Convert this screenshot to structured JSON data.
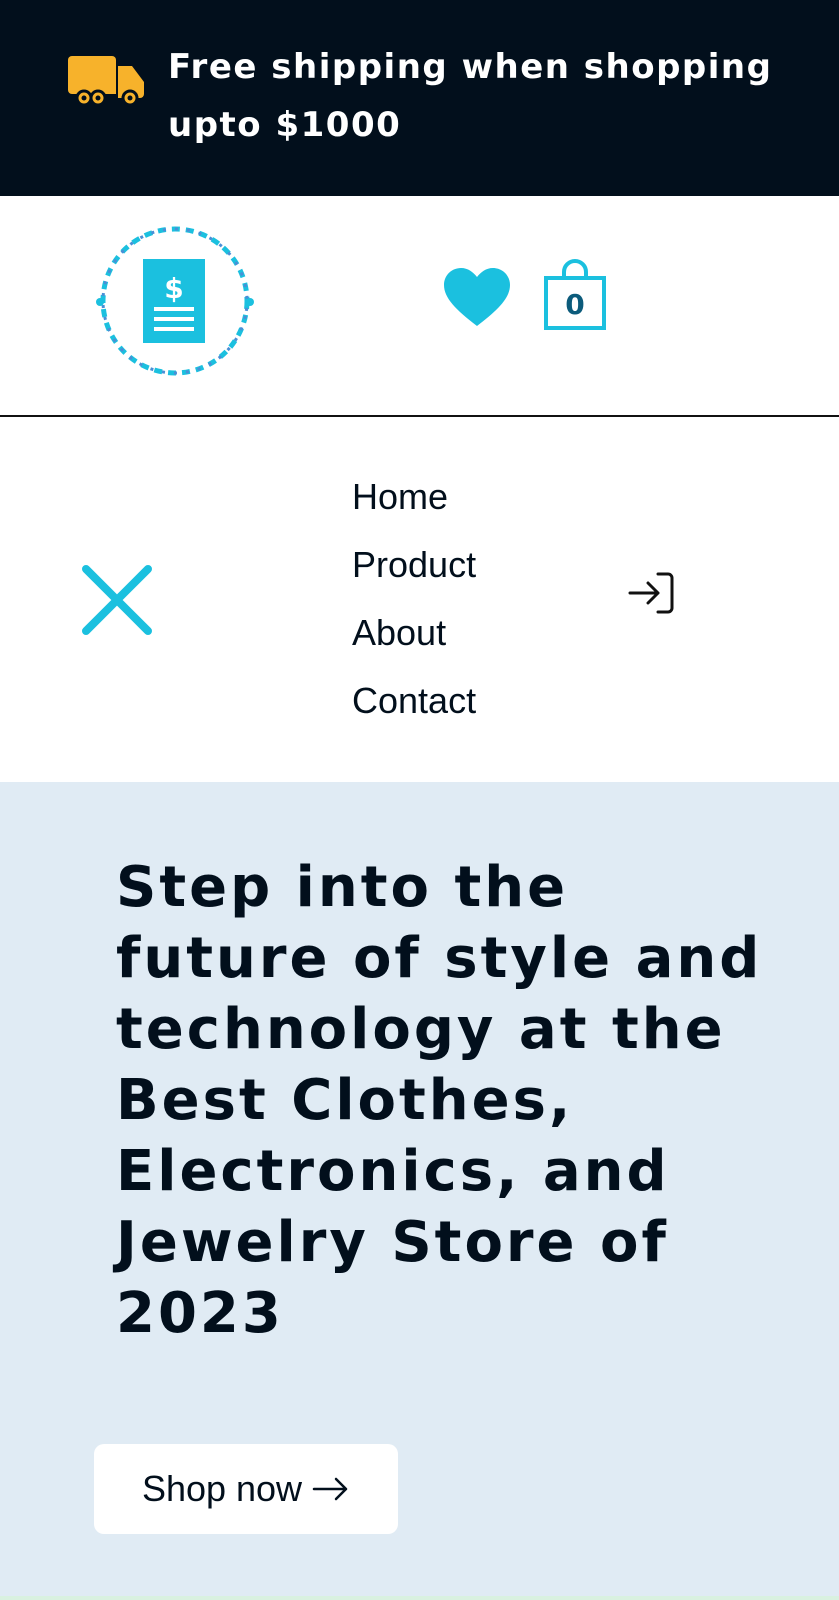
{
  "promo": {
    "line1": "Free shipping when shopping",
    "line2": "upto $1000",
    "icon": "truck-icon"
  },
  "header": {
    "logo_icon": "receipt-dollar-logo",
    "wishlist_icon": "heart-icon",
    "cart_icon": "shopping-bag-icon",
    "cart_count": "0"
  },
  "menu": {
    "close_icon": "close-icon",
    "items": [
      {
        "label": "Home"
      },
      {
        "label": "Product"
      },
      {
        "label": "About"
      },
      {
        "label": "Contact"
      }
    ],
    "login_icon": "login-icon"
  },
  "hero": {
    "title": "Step into the future of style and technology at the Best Clothes, Electronics, and Jewelry Store of 2023",
    "cta_label": "Shop now",
    "cta_icon": "arrow-right-icon"
  },
  "colors": {
    "dark": "#020f1c",
    "accent": "#1bc0df",
    "truck": "#f7b22b",
    "hero_bg": "#e0ebf4"
  }
}
